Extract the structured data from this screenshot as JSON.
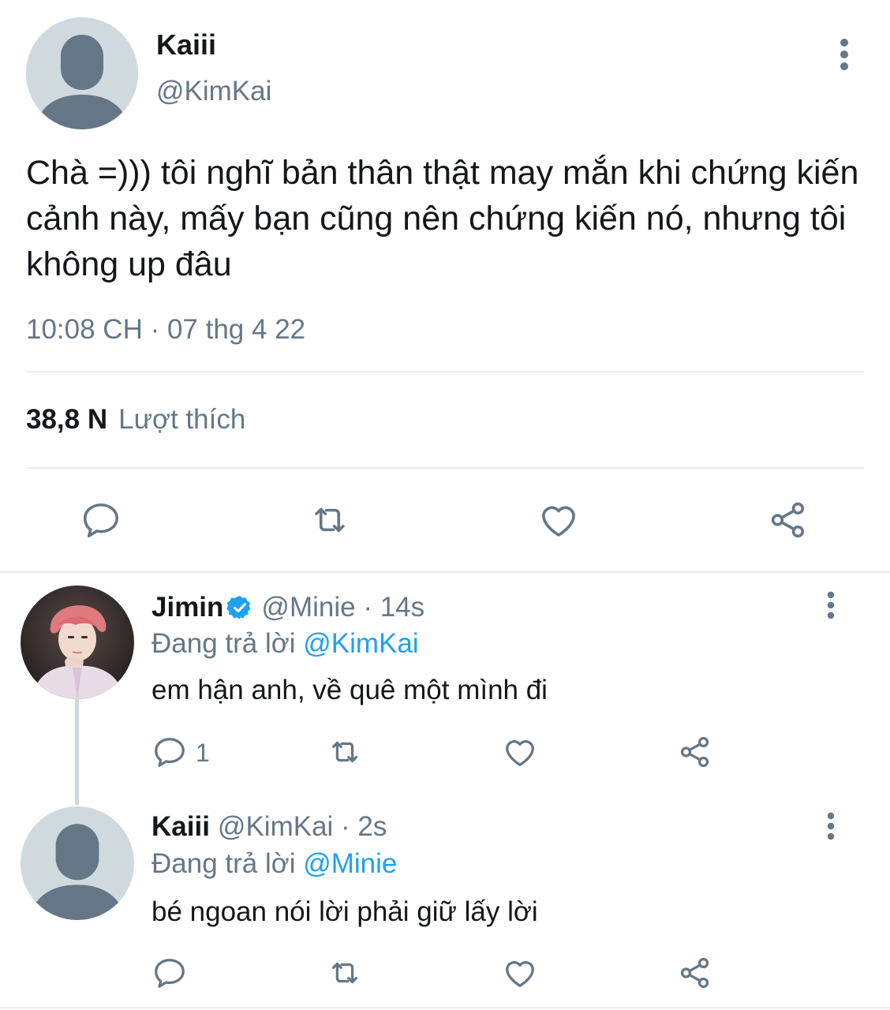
{
  "main_tweet": {
    "name": "Kaiii",
    "handle": "@KimKai",
    "text": "Chà =))) tôi nghĩ bản thân thật may mắn khi chứng kiến cảnh này, mấy bạn cũng nên chứng kiến nó, nhưng tôi không up đâu",
    "timestamp": "10:08 CH · 07 thg 4 22",
    "likes_count": "38,8 N",
    "likes_label": "Lượt thích",
    "avatar_icon": "default-avatar-icon",
    "actions": [
      "reply-icon",
      "retweet-icon",
      "like-icon",
      "share-icon"
    ]
  },
  "replies": [
    {
      "name": "Jimin",
      "verified": true,
      "handle_time": "@Minie · 14s",
      "replying_prefix": "Đang trả lời",
      "replying_to": "@KimKai",
      "text": "em hận anh, về quê một mình đi",
      "reply_count": "1",
      "avatar_icon": "photo-avatar"
    },
    {
      "name": "Kaiii",
      "verified": false,
      "handle_time": "@KimKai · 2s",
      "replying_prefix": "Đang trả lời",
      "replying_to": "@Minie",
      "text": "bé ngoan nói lời phải giữ lấy lời",
      "reply_count": "",
      "avatar_icon": "default-avatar-icon"
    }
  ],
  "colors": {
    "text_primary": "#14171a",
    "text_secondary": "#657786",
    "link": "#1da1f2",
    "divider": "#e6ecf0",
    "avatar_bg": "#cfd9de",
    "avatar_figure": "#657786"
  }
}
